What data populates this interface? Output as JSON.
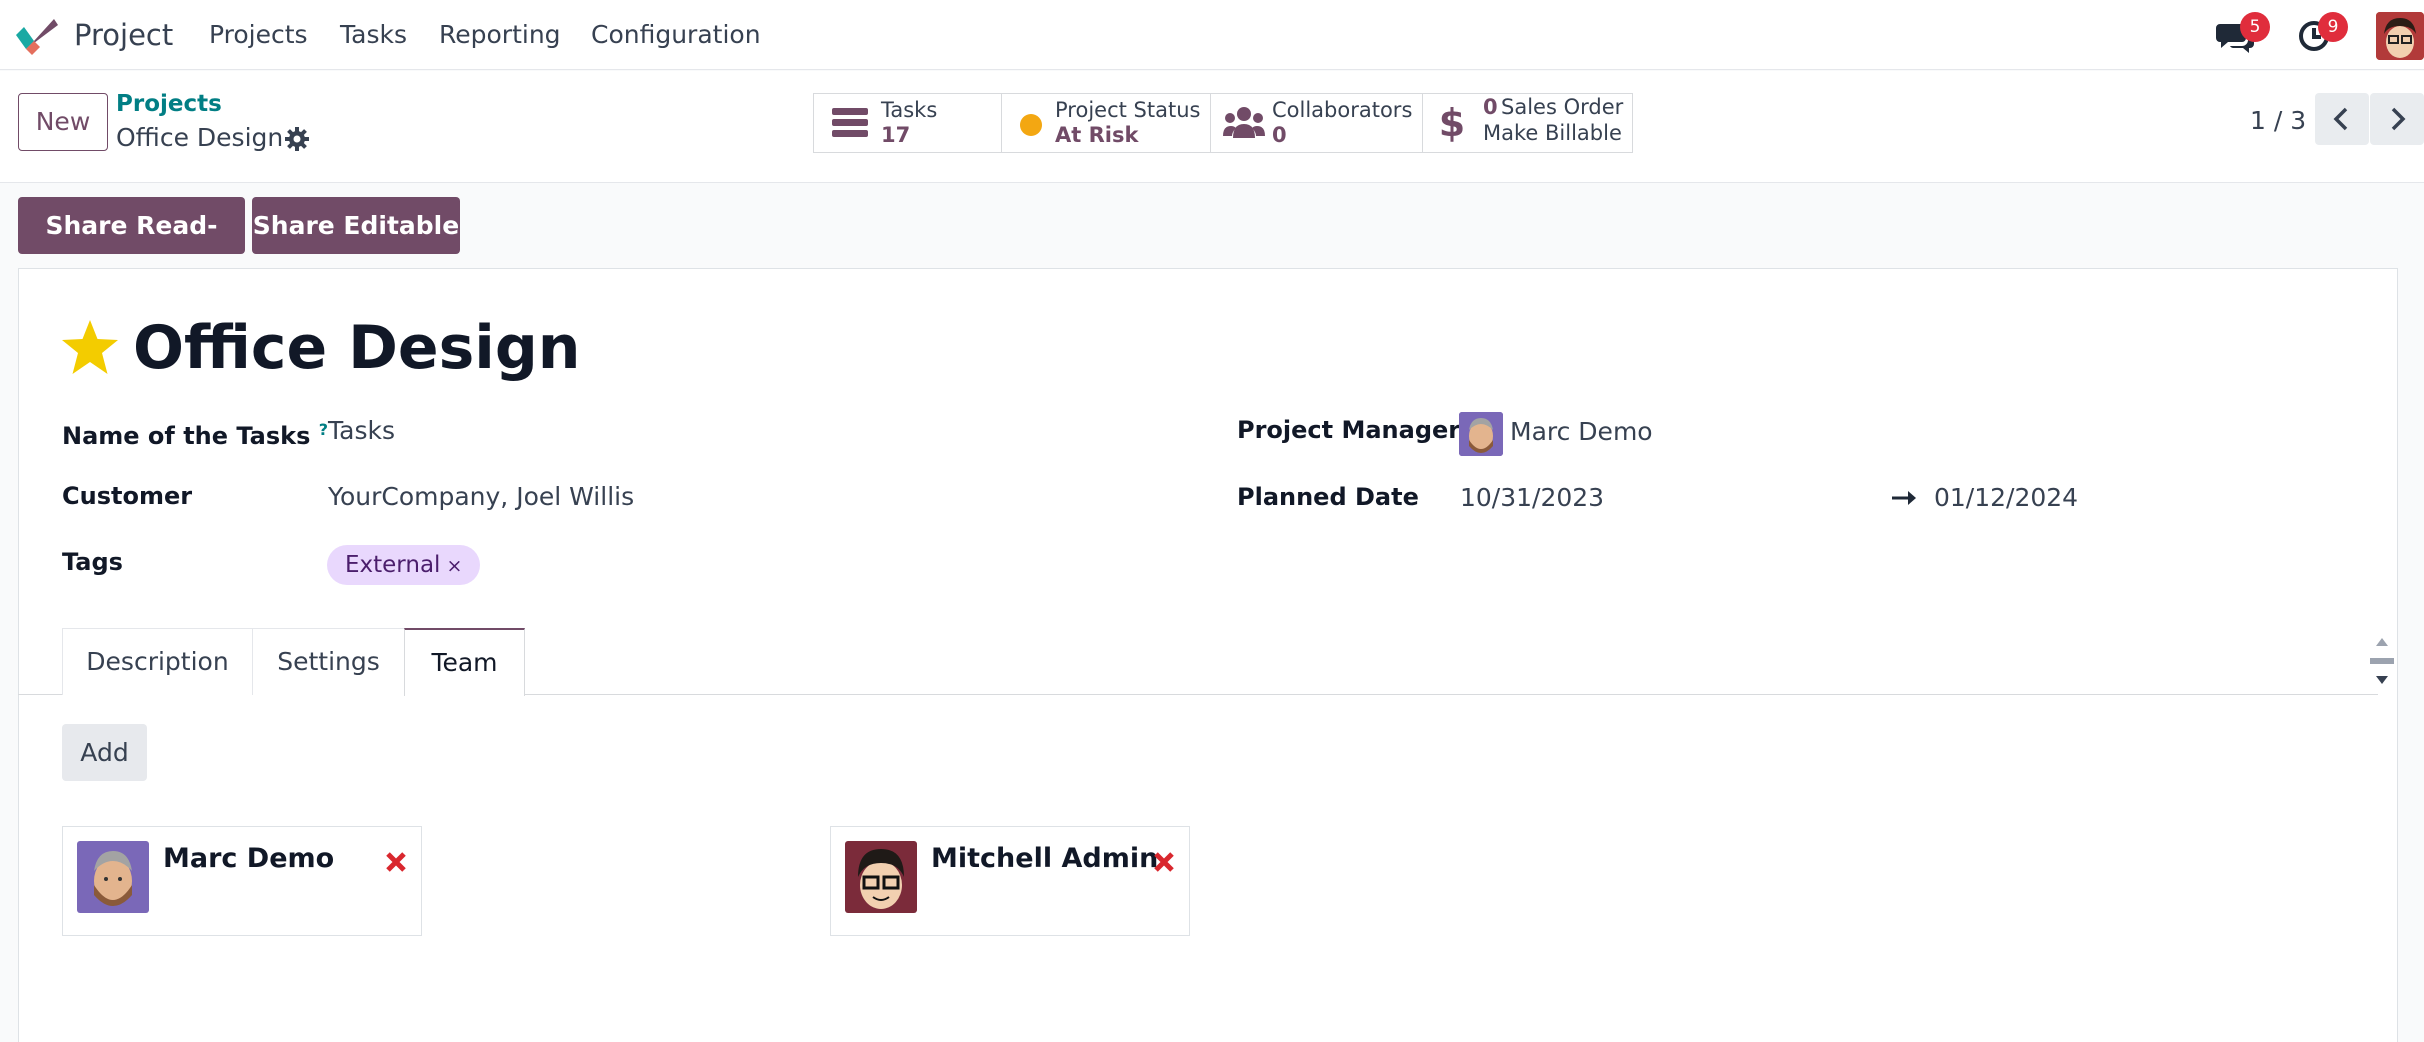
{
  "navbar": {
    "app_name": "Project",
    "menu": [
      "Projects",
      "Tasks",
      "Reporting",
      "Configuration"
    ],
    "messages_count": "5",
    "activities_count": "9"
  },
  "control_panel": {
    "new_label": "New",
    "breadcrumb_parent": "Projects",
    "record_name": "Office Design",
    "stats": {
      "tasks_label": "Tasks",
      "tasks_value": "17",
      "status_label": "Project Status",
      "status_value": "At Risk",
      "collaborators_label": "Collaborators",
      "collaborators_value": "0",
      "sales_count": "0",
      "sales_label": "Sales Order",
      "billable_label": "Make Billable"
    },
    "pager": "1 / 3"
  },
  "share": {
    "readonly_label": "Share Read-only",
    "editable_label": "Share Editable"
  },
  "form": {
    "title": "Office Design",
    "favorite": true,
    "labels": {
      "task_name": "Name of the Tasks",
      "help": "?",
      "customer": "Customer",
      "tags": "Tags",
      "manager": "Project Manager",
      "planned_date": "Planned Date"
    },
    "values": {
      "task_name": "Tasks",
      "customer": "YourCompany, Joel Willis",
      "manager": "Marc Demo",
      "date_start": "10/31/2023",
      "date_end": "01/12/2024"
    },
    "tags": [
      {
        "label": "External",
        "remove": "×"
      }
    ]
  },
  "tabs": [
    "Description",
    "Settings",
    "Team"
  ],
  "active_tab": "Team",
  "team": {
    "add_label": "Add",
    "members": [
      "Marc Demo",
      "Mitchell Admin"
    ]
  },
  "colors": {
    "brand": "#714b67",
    "link": "#017e84",
    "status_at_risk": "#f3a712",
    "badge": "#e02d3c",
    "favorite": "#f3cc00",
    "remove": "#d9272e"
  }
}
